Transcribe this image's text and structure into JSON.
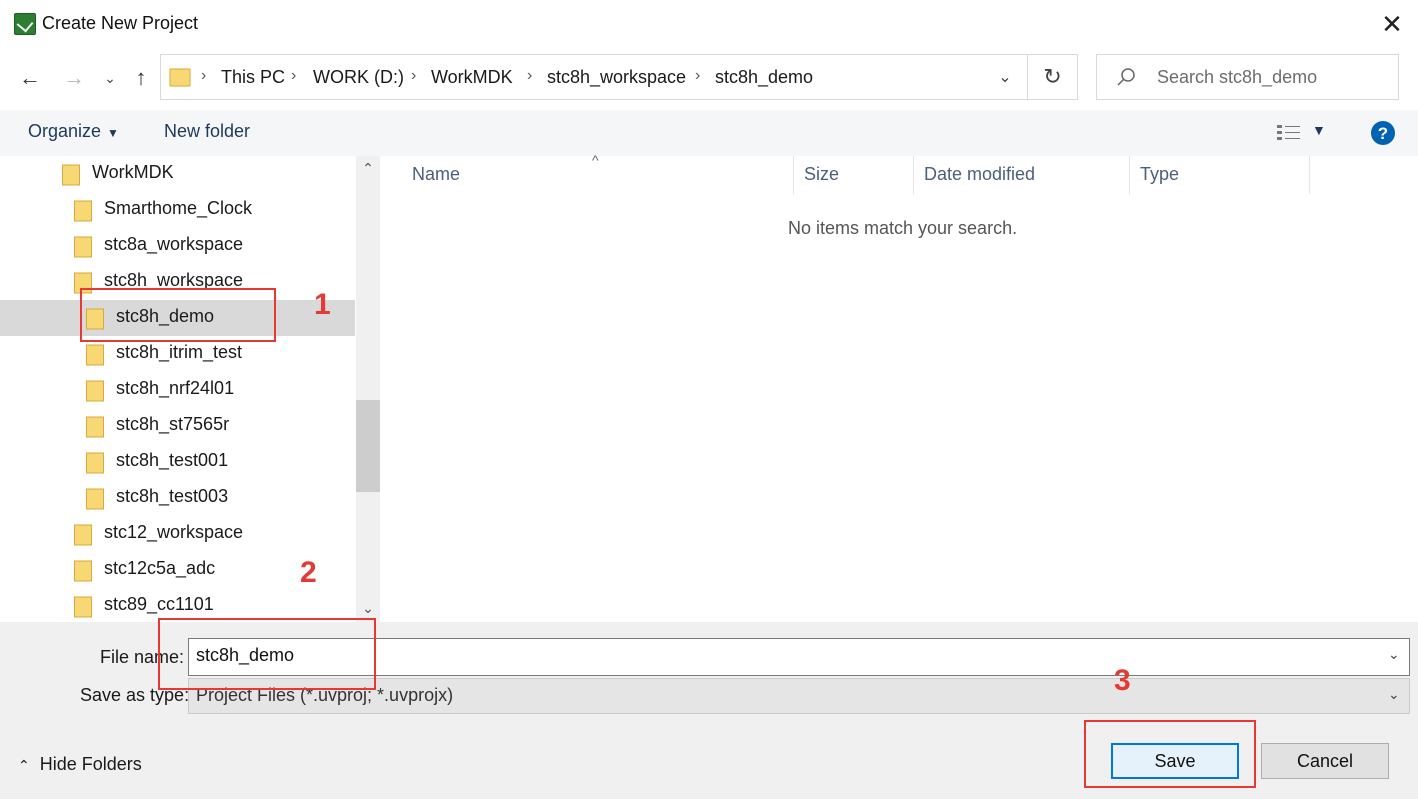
{
  "window": {
    "title": "Create New Project"
  },
  "address": {
    "breadcrumbs": [
      "This PC",
      "WORK (D:)",
      "WorkMDK",
      "stc8h_workspace",
      "stc8h_demo"
    ]
  },
  "search": {
    "placeholder": "Search stc8h_demo"
  },
  "toolbar": {
    "organize_label": "Organize",
    "new_folder_label": "New folder"
  },
  "nav": {
    "items": [
      {
        "label": "WorkMDK",
        "level": 0,
        "selected": false
      },
      {
        "label": "Smarthome_Clock",
        "level": 1,
        "selected": false
      },
      {
        "label": "stc8a_workspace",
        "level": 1,
        "selected": false
      },
      {
        "label": "stc8h_workspace",
        "level": 1,
        "selected": false
      },
      {
        "label": "stc8h_demo",
        "level": 2,
        "selected": true
      },
      {
        "label": "stc8h_itrim_test",
        "level": 2,
        "selected": false
      },
      {
        "label": "stc8h_nrf24l01",
        "level": 2,
        "selected": false
      },
      {
        "label": "stc8h_st7565r",
        "level": 2,
        "selected": false
      },
      {
        "label": "stc8h_test001",
        "level": 2,
        "selected": false
      },
      {
        "label": "stc8h_test003",
        "level": 2,
        "selected": false
      },
      {
        "label": "stc12_workspace",
        "level": 1,
        "selected": false
      },
      {
        "label": "stc12c5a_adc",
        "level": 1,
        "selected": false
      },
      {
        "label": "stc89_cc1101",
        "level": 1,
        "selected": false
      }
    ]
  },
  "filelist": {
    "columns": [
      "Name",
      "Size",
      "Date modified",
      "Type"
    ],
    "empty_message": "No items match your search."
  },
  "form": {
    "file_name_label": "File name:",
    "file_name_value": "stc8h_demo",
    "save_type_label": "Save as type:",
    "save_type_value": "Project Files (*.uvproj; *.uvprojx)"
  },
  "footer": {
    "hide_folders_label": "Hide Folders"
  },
  "buttons": {
    "save": "Save",
    "cancel": "Cancel"
  },
  "annotations": [
    "1",
    "2",
    "3"
  ],
  "colors": {
    "folder": "#f8d775",
    "accent": "#0078d7",
    "annotation": "#e53935"
  }
}
